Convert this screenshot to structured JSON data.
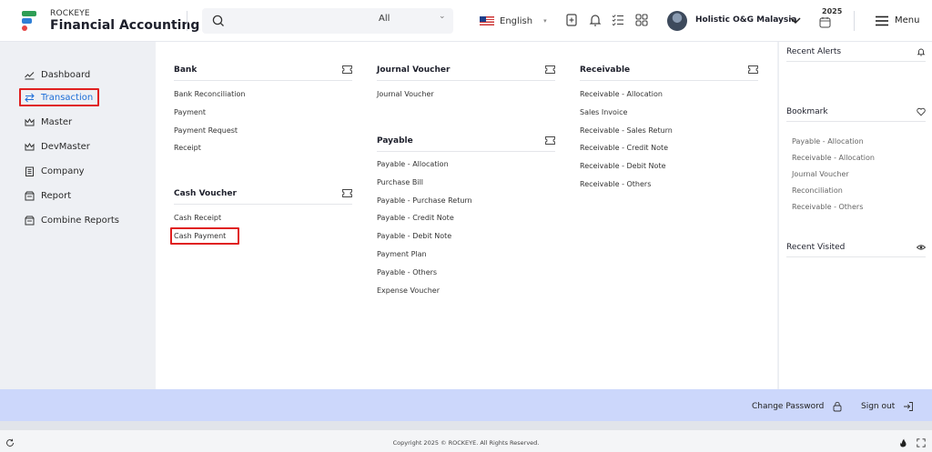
{
  "brand": {
    "sub": "ROCKEYE",
    "title": "Financial Accounting"
  },
  "search": {
    "placeholder": "",
    "scope": "All"
  },
  "language": {
    "label": "English"
  },
  "organization": {
    "name": "Holistic O&G Malaysia"
  },
  "year": {
    "label": "2025"
  },
  "menu": {
    "label": "Menu"
  },
  "sidebar": {
    "items": [
      {
        "label": "Dashboard",
        "icon": "chart-line-icon"
      },
      {
        "label": "Transaction",
        "icon": "arrows-exchange-icon",
        "active": true
      },
      {
        "label": "Master",
        "icon": "crown-icon"
      },
      {
        "label": "DevMaster",
        "icon": "crown-icon"
      },
      {
        "label": "Company",
        "icon": "building-icon"
      },
      {
        "label": "Report",
        "icon": "report-icon"
      },
      {
        "label": "Combine Reports",
        "icon": "report-icon"
      }
    ]
  },
  "sections": {
    "bank": {
      "title": "Bank",
      "links": [
        "Bank Reconciliation",
        "Payment",
        "Payment Request",
        "Receipt"
      ]
    },
    "cash_voucher": {
      "title": "Cash Voucher",
      "links": [
        "Cash Receipt",
        "Cash Payment"
      ]
    },
    "journal_voucher": {
      "title": "Journal Voucher",
      "links": [
        "Journal Voucher"
      ]
    },
    "payable": {
      "title": "Payable",
      "links": [
        "Payable - Allocation",
        "Purchase Bill",
        "Payable - Purchase Return",
        "Payable - Credit Note",
        "Payable - Debit Note",
        "Payment Plan",
        "Payable - Others",
        "Expense Voucher"
      ]
    },
    "receivable": {
      "title": "Receivable",
      "links": [
        "Receivable - Allocation",
        "Sales Invoice",
        "Receivable - Sales Return",
        "Receivable - Credit Note",
        "Receivable - Debit Note",
        "Receivable - Others"
      ]
    }
  },
  "right_panel": {
    "recent_alerts": {
      "title": "Recent Alerts"
    },
    "bookmark": {
      "title": "Bookmark",
      "items": [
        "Payable - Allocation",
        "Receivable - Allocation",
        "Journal Voucher",
        "Reconciliation",
        "Receivable - Others"
      ]
    },
    "recent_visited": {
      "title": "Recent Visited"
    }
  },
  "footer": {
    "change_password": "Change Password",
    "sign_out": "Sign out"
  },
  "copyright": "Copyright 2025 © ROCKEYE. All Rights Reserved.",
  "colors": {
    "accent": "#1e6ed8",
    "highlight": "#e02020",
    "footer_bar": "#ccd7fb"
  }
}
